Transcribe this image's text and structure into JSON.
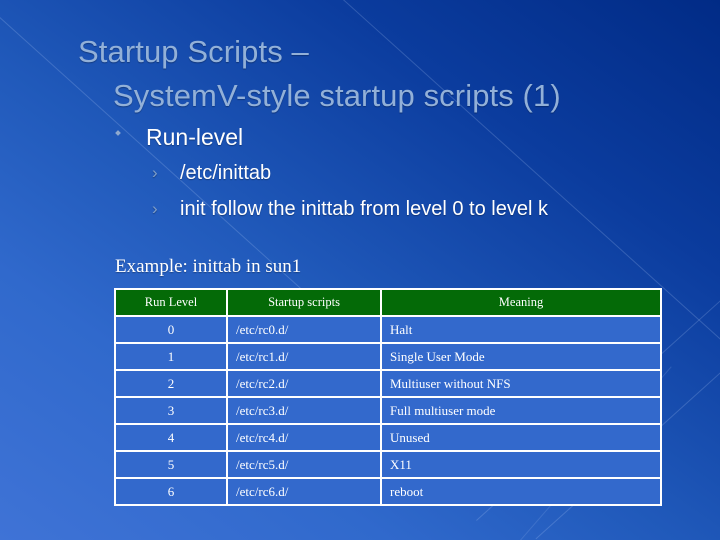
{
  "slide": {
    "title_line1": "Startup Scripts –",
    "title_line2": "SystemV-style startup scripts (1)",
    "bullets": [
      {
        "level": 1,
        "marker": "diamond-bullet",
        "text": "Run-level"
      },
      {
        "level": 2,
        "marker": "chevron-bullet",
        "text": "/etc/inittab"
      },
      {
        "level": 2,
        "marker": "chevron-bullet",
        "text": "init follow the inittab from level 0 to level k"
      }
    ],
    "chevron_glyph": "›",
    "example_caption": "Example: inittab in sun1"
  },
  "table": {
    "headers": [
      "Run Level",
      "Startup scripts",
      "Meaning"
    ],
    "rows": [
      [
        "0",
        "/etc/rc0.d/",
        "Halt"
      ],
      [
        "1",
        "/etc/rc1.d/",
        "Single User Mode"
      ],
      [
        "2",
        "/etc/rc2.d/",
        "Multiuser without NFS"
      ],
      [
        "3",
        "/etc/rc3.d/",
        "Full multiuser mode"
      ],
      [
        "4",
        "/etc/rc4.d/",
        "Unused"
      ],
      [
        "5",
        "/etc/rc5.d/",
        "X11"
      ],
      [
        "6",
        "/etc/rc6.d/",
        "reboot"
      ]
    ]
  },
  "colors": {
    "background_dark": "#012b86",
    "background_light": "#3f73d6",
    "title_text": "#92b0d8",
    "body_text": "#ffffff",
    "table_header_green": "#046a07",
    "table_cell_blue": "#3369cc",
    "table_border": "#ffffff"
  }
}
